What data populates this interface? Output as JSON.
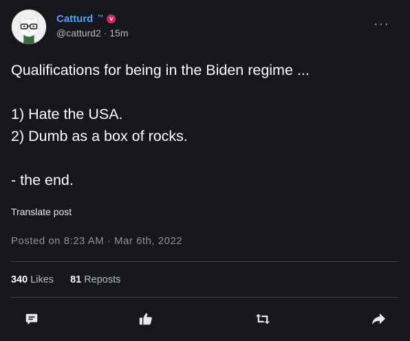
{
  "author": {
    "display_name": "Catturd",
    "trademark": "™",
    "verified_badge": "v",
    "handle": "@catturd2",
    "separator": "·",
    "time_ago": "15m",
    "avatar_icon": "cat-with-glasses-avatar"
  },
  "post": {
    "text": "Qualifications for being in the Biden regime ...\n\n1) Hate the USA.\n2) Dumb as a box of rocks.\n\n- the end.",
    "translate_label": "Translate post",
    "posted_on": "Posted on 8:23 AM · Mar 6th, 2022"
  },
  "stats": {
    "likes_count": "340",
    "likes_label": "Likes",
    "reposts_count": "81",
    "reposts_label": "Reposts"
  },
  "actions": [
    {
      "name": "reply",
      "icon": "comment-icon"
    },
    {
      "name": "like",
      "icon": "thumbs-up-icon"
    },
    {
      "name": "repost",
      "icon": "repost-icon"
    },
    {
      "name": "share",
      "icon": "share-arrow-icon"
    }
  ],
  "colors": {
    "background": "#15171c",
    "accent": "#4da3ff",
    "badge": "#e0245e",
    "muted": "#8f949a",
    "divider": "#3a3d42"
  }
}
